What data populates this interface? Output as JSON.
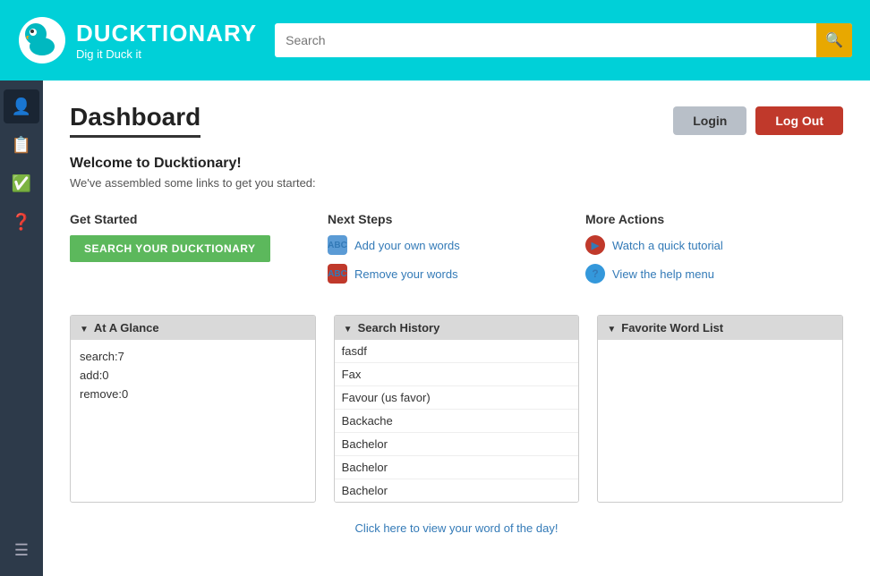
{
  "header": {
    "logo_title": "DUCKTIONARY",
    "logo_subtitle": "Dig it Duck it",
    "search_placeholder": "Search"
  },
  "sidebar": {
    "items": [
      {
        "name": "profile",
        "icon": "👤"
      },
      {
        "name": "book",
        "icon": "📋"
      },
      {
        "name": "checklist",
        "icon": "✅"
      },
      {
        "name": "help",
        "icon": "❓"
      }
    ],
    "hamburger_icon": "☰"
  },
  "dashboard": {
    "title": "Dashboard",
    "login_label": "Login",
    "logout_label": "Log Out",
    "welcome_title": "Welcome to Ducktionary!",
    "welcome_subtitle": "We've assembled some links to get you started:"
  },
  "get_started": {
    "title": "Get Started",
    "button_label": "SEARCH YOUR DUCKTIONARY"
  },
  "next_steps": {
    "title": "Next Steps",
    "links": [
      {
        "label": "Add your own words",
        "type": "add"
      },
      {
        "label": "Remove your words",
        "type": "remove"
      }
    ]
  },
  "more_actions": {
    "title": "More Actions",
    "links": [
      {
        "label": "Watch a quick tutorial",
        "type": "tutorial"
      },
      {
        "label": "View the help menu",
        "type": "help"
      }
    ]
  },
  "at_a_glance": {
    "panel_title": "At A Glance",
    "items": [
      {
        "text": "search:7"
      },
      {
        "text": "add:0"
      },
      {
        "text": "remove:0"
      }
    ]
  },
  "search_history": {
    "panel_title": "Search History",
    "items": [
      {
        "text": "fasdf"
      },
      {
        "text": "Fax"
      },
      {
        "text": "Favour (us favor)"
      },
      {
        "text": "Backache"
      },
      {
        "text": "Bachelor"
      },
      {
        "text": "Bachelor"
      },
      {
        "text": "Bachelor"
      }
    ]
  },
  "favorite_word_list": {
    "panel_title": "Favorite Word List",
    "items": []
  },
  "word_of_day": {
    "link_text": "Click here to view your word of the day!"
  }
}
